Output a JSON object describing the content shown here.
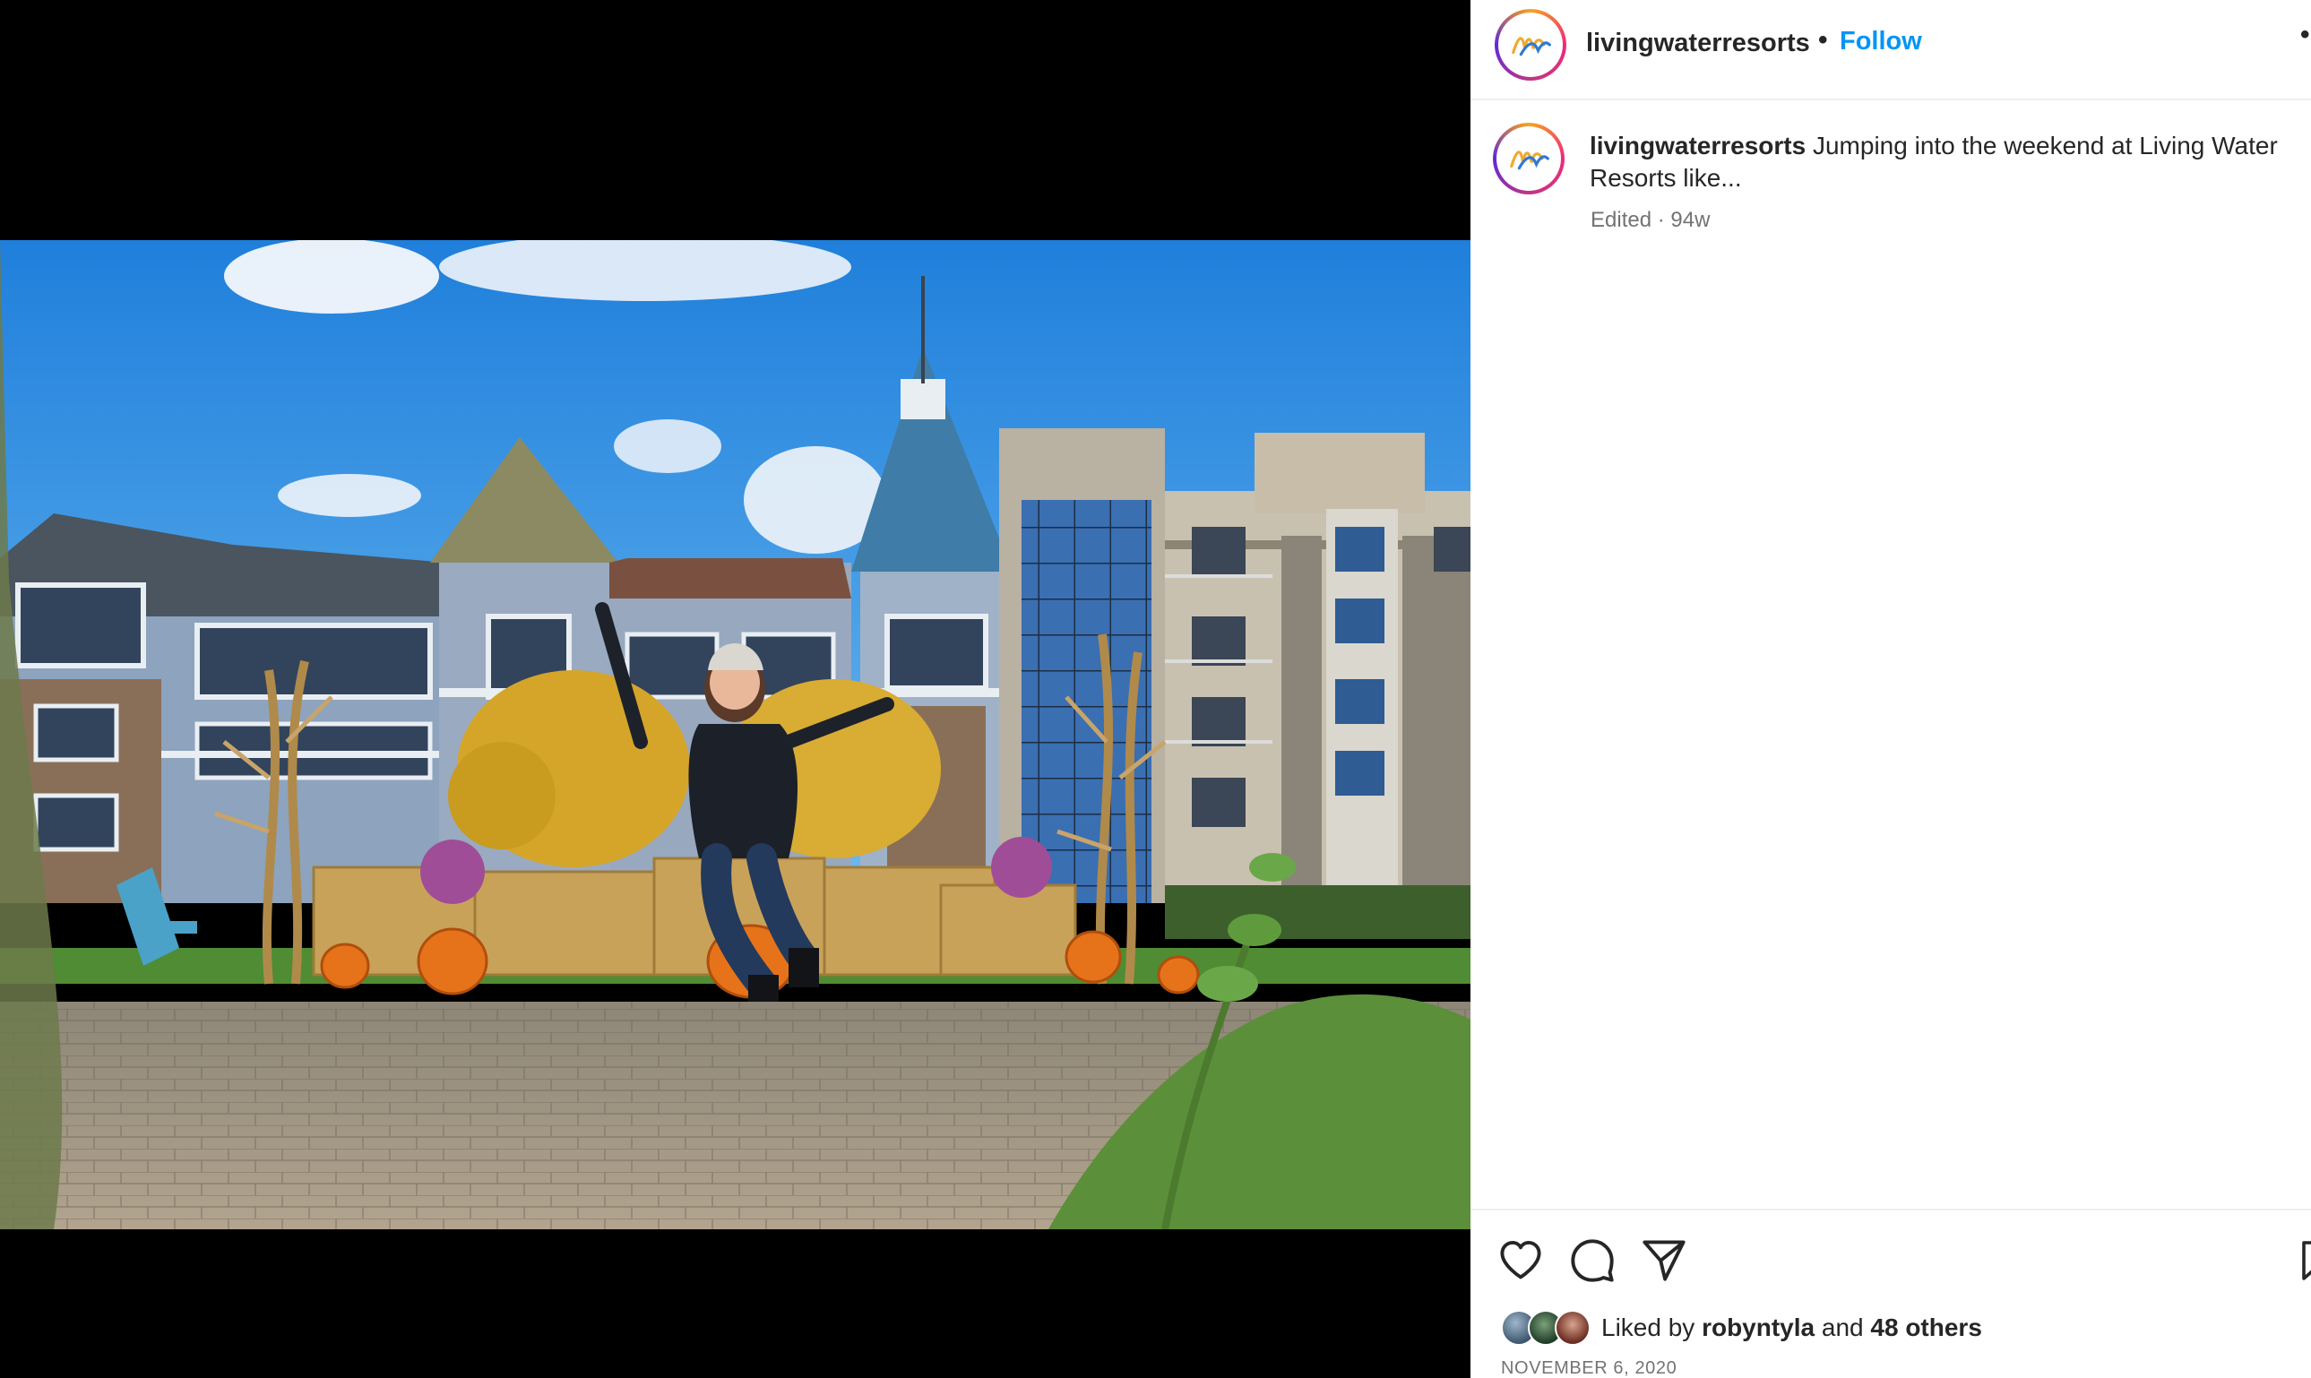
{
  "post": {
    "username": "livingwaterresorts",
    "separator": "•",
    "follow_label": "Follow",
    "more_label": "•",
    "caption": "Jumping into the weekend at Living Water Resorts like...",
    "edited_label": "Edited · 94w",
    "likes": {
      "prefix": "Liked by",
      "user": "robyntyla",
      "conjunction": "and",
      "others": "48 others"
    },
    "date": "NOVEMBER 6, 2020"
  },
  "icons": {
    "like": "heart-icon",
    "comment": "comment-bubble-icon",
    "share": "paper-plane-icon",
    "save": "bookmark-icon"
  },
  "colors": {
    "accent": "#0095f6",
    "text": "#262626",
    "muted": "#737373",
    "divider": "#efefef",
    "media_bg": "#000000"
  }
}
